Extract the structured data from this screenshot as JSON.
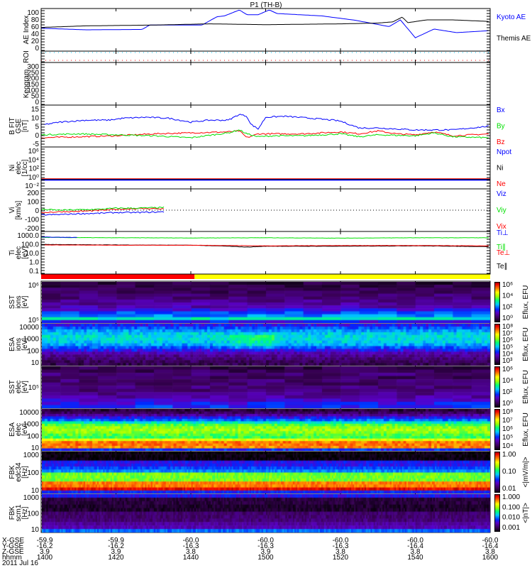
{
  "title": "P1 (TH-B)",
  "time_axis": {
    "rows": [
      {
        "label": "X-GSE",
        "values": [
          "-59.9",
          "-59.9",
          "-60.0",
          "-60.0",
          "-60.0",
          "-60.0",
          "-60.0"
        ]
      },
      {
        "label": "Y-GSE",
        "values": [
          "-16.2",
          "-16.2",
          "-16.3",
          "-16.3",
          "-16.3",
          "-16.4",
          "-16.4"
        ]
      },
      {
        "label": "Z-GSE",
        "values": [
          "3.9",
          "3.9",
          "3.8",
          "3.9",
          "3.8",
          "3.8",
          "3.8"
        ]
      },
      {
        "label": "hhmm",
        "values": [
          "1400",
          "1420",
          "1440",
          "1500",
          "1520",
          "1540",
          "1600"
        ]
      }
    ],
    "date": "2011 Jul 16"
  },
  "colors": {
    "blue": "#0000ff",
    "red": "#ff0000",
    "green": "#00e000",
    "black": "#000000",
    "cyan": "#00c8ff",
    "yellow": "#ffff00"
  },
  "chart_data": [
    {
      "type": "line",
      "name": "ae",
      "ylabel": "AE Index",
      "ylim": [
        0,
        100
      ],
      "ticks": [
        "100",
        "80",
        "60",
        "40",
        "20",
        "0"
      ],
      "series": [
        {
          "name": "Kyoto AE",
          "color": "#0000ff",
          "t": [
            0,
            12,
            27,
            29,
            43,
            47,
            49,
            53,
            55,
            58,
            61,
            63,
            75,
            84,
            93,
            96,
            100,
            105,
            111,
            120
          ],
          "v": [
            54,
            50,
            51,
            62,
            62,
            83,
            85,
            100,
            88,
            88,
            100,
            91,
            85,
            74,
            58,
            75,
            30,
            52,
            43,
            48
          ]
        },
        {
          "name": "Themis AE",
          "color": "#000000",
          "t": [
            0,
            12,
            30,
            45,
            60,
            80,
            90,
            94,
            96.5,
            98,
            103,
            110,
            120
          ],
          "v": [
            56,
            60,
            62,
            65,
            63,
            65,
            67,
            70,
            82,
            68,
            75,
            75,
            71
          ]
        }
      ]
    },
    {
      "type": "line",
      "name": "roi",
      "ylabel": "ROI",
      "series": [
        {
          "name": "roi-cyan",
          "color": "#00c8ff"
        },
        {
          "name": "roi-red",
          "color": "#ff0000"
        }
      ]
    },
    {
      "type": "line",
      "name": "keogram",
      "ylabel": "Keogram",
      "ylim": [
        0,
        300
      ],
      "ticks": [
        "300",
        "250",
        "200",
        "150",
        "100",
        "50",
        "0"
      ],
      "series": []
    },
    {
      "type": "line",
      "name": "bfield",
      "ylabel": "B FIT",
      "units": [
        "GSE",
        "[nT]"
      ],
      "ylim": [
        -5,
        15
      ],
      "ticks": [
        "15",
        "10",
        "5",
        "0",
        "-5"
      ],
      "series": [
        {
          "name": "Bz",
          "color": "#ff0000",
          "t": [
            0,
            10,
            20,
            30,
            40,
            50,
            53,
            55,
            58,
            62,
            70,
            80,
            85,
            90,
            95,
            100,
            105,
            110,
            120
          ],
          "v": [
            -1,
            -0.5,
            0,
            1,
            1.5,
            2,
            2.5,
            -1,
            1,
            1,
            1,
            2,
            1,
            2.5,
            1,
            0.5,
            2,
            0,
            1
          ]
        },
        {
          "name": "By",
          "color": "#00e000",
          "t": [
            0,
            10,
            20,
            30,
            40,
            50,
            53,
            55,
            58,
            62,
            70,
            80,
            85,
            90,
            100,
            105,
            110,
            120
          ],
          "v": [
            0.5,
            1,
            0.5,
            0,
            -1,
            1.5,
            3,
            1,
            -0.5,
            0,
            0,
            1,
            -0.5,
            0.5,
            0,
            1.5,
            -0.5,
            -1
          ]
        },
        {
          "name": "Bx",
          "color": "#0000ff",
          "t": [
            0,
            5,
            12,
            18,
            22,
            28,
            34,
            40,
            45,
            50,
            53,
            55,
            56,
            58,
            60,
            65,
            72,
            78,
            80,
            85,
            90,
            100,
            110,
            120
          ],
          "v": [
            5.5,
            7,
            8,
            8,
            9,
            9.5,
            9,
            7,
            8,
            8,
            11,
            10,
            6,
            3.5,
            9.5,
            10,
            9,
            8,
            7.5,
            4,
            4,
            3,
            3,
            5
          ]
        }
      ]
    },
    {
      "type": "line",
      "name": "density",
      "ylabel": "Ni",
      "units": [
        "elec",
        "[1/cc]"
      ],
      "ylim_log10": [
        -2,
        6
      ],
      "ticks": [
        "10⁶",
        "10⁴",
        "10²",
        "10⁰",
        "10⁻²"
      ],
      "series": [
        {
          "name": "Ne",
          "color": "#ff0000",
          "const": -0.6
        },
        {
          "name": "Ni",
          "color": "#000000",
          "const": -0.65
        },
        {
          "name": "Npot",
          "color": "#0000ff",
          "const": -0.7
        }
      ]
    },
    {
      "type": "line",
      "name": "velocity",
      "ylabel": "Vi",
      "units": [
        "[km/s]"
      ],
      "ylim": [
        -250,
        250
      ],
      "ticks": [
        "200",
        "100",
        "0",
        "-100",
        "-200"
      ],
      "series": [
        {
          "name": "Vix",
          "color": "#ff0000",
          "t": [
            0,
            5,
            10,
            15,
            20,
            25,
            30,
            33
          ],
          "v": [
            -30,
            -20,
            -15,
            -5,
            10,
            20,
            20,
            15
          ]
        },
        {
          "name": "Viy",
          "color": "#00e000",
          "t": [
            0,
            5,
            10,
            15,
            20,
            25,
            30,
            33
          ],
          "v": [
            10,
            0,
            5,
            10,
            25,
            25,
            30,
            35
          ]
        },
        {
          "name": "Viz",
          "color": "#0000ff",
          "t": [
            0,
            5,
            10,
            15,
            20,
            25,
            30,
            33
          ],
          "v": [
            -60,
            -55,
            -45,
            -40,
            -30,
            -30,
            -25,
            -20
          ]
        }
      ]
    },
    {
      "type": "line",
      "name": "temperature",
      "ylabel": "Ti",
      "units": [
        "elec",
        "[eV]"
      ],
      "ylim_log10": [
        -1.3,
        3.6
      ],
      "ticks": [
        "1000.0",
        "100.0",
        "10.0",
        "1.0",
        "0.1"
      ],
      "series": [
        {
          "name": "Te∥",
          "color": "#000000",
          "t": [
            0,
            20,
            40,
            50,
            55,
            60,
            80,
            100,
            110,
            120
          ],
          "v": [
            150,
            130,
            120,
            90,
            70,
            90,
            90,
            100,
            90,
            80
          ]
        },
        {
          "name": "Te⊥",
          "color": "#ff0000",
          "t": [
            0,
            20,
            40,
            60,
            80,
            100,
            120
          ],
          "v": [
            130,
            120,
            120,
            100,
            110,
            110,
            100
          ]
        },
        {
          "name": "Ti∥",
          "color": "#00e000",
          "t": [
            0,
            20,
            40,
            60,
            80,
            100,
            120
          ],
          "v": [
            1100,
            1000,
            950,
            1000,
            900,
            1000,
            1000
          ]
        },
        {
          "name": "Ti⊥",
          "color": "#0000ff",
          "t": [
            0,
            5,
            10
          ],
          "v": [
            1200,
            1150,
            1100
          ]
        }
      ]
    },
    {
      "type": "heatmap",
      "name": "sst-ion",
      "ylabel": "SST",
      "units": [
        "ions",
        "[eV]"
      ],
      "ticks": [
        "10⁶",
        "10⁵"
      ],
      "colorbar": {
        "label": "Eflux, EFU",
        "ticks": [
          "10⁶",
          "10⁴",
          "10²",
          "10⁰"
        ]
      },
      "profile": [
        0.08,
        0.1,
        0.12,
        0.12,
        0.15,
        0.15,
        0.18,
        0.2,
        0.22,
        0.28,
        0.35,
        0.4,
        0.5,
        0.3
      ]
    },
    {
      "type": "heatmap",
      "name": "esa-ion",
      "ylabel": "ESA",
      "units": [
        "ions",
        "[eV]"
      ],
      "ticks": [
        "10000",
        "1000",
        "100",
        "10"
      ],
      "colorbar": {
        "label": "Eflux, EFU",
        "ticks": [
          "10⁸",
          "10⁷",
          "10⁶",
          "10⁵",
          "10⁴",
          "10³"
        ]
      },
      "profile": [
        0.3,
        0.36,
        0.42,
        0.46,
        0.48,
        0.48,
        0.46,
        0.42,
        0.36,
        0.3,
        0.22,
        0.18,
        0.15,
        0.12,
        0.1
      ]
    },
    {
      "type": "heatmap",
      "name": "sst-elec",
      "ylabel": "SST",
      "units": [
        "elec",
        "[eV]"
      ],
      "ticks": [
        "10⁵"
      ],
      "colorbar": {
        "label": "Eflux, EFU",
        "ticks": [
          "10⁶",
          "10⁴",
          "10²",
          "10⁰"
        ]
      },
      "profile": [
        0.1,
        0.12,
        0.15,
        0.12,
        0.15,
        0.14,
        0.16,
        0.15,
        0.18,
        0.2,
        0.25,
        0.3,
        0.33
      ]
    },
    {
      "type": "heatmap",
      "name": "esa-elec",
      "ylabel": "ESA",
      "units": [
        "elec",
        "[eV]"
      ],
      "ticks": [
        "10000",
        "1000",
        "100",
        "10"
      ],
      "colorbar": {
        "label": "Eflux, EFU",
        "ticks": [
          "10⁸",
          "10⁷",
          "10⁶",
          "10⁵",
          "10⁴"
        ]
      },
      "profile": [
        0.08,
        0.12,
        0.2,
        0.3,
        0.38,
        0.5,
        0.6,
        0.64,
        0.66,
        0.64,
        0.6,
        0.58,
        0.72,
        0.85,
        0.86,
        0.84,
        0.33
      ]
    },
    {
      "type": "heatmap",
      "name": "fbk-edc34",
      "ylabel": "FBK",
      "units": [
        "edc34",
        "[Hz]"
      ],
      "ticks": [
        "1000",
        "100",
        "10"
      ],
      "colorbar": {
        "label": "<|mV/m|>",
        "ticks": [
          "1.00",
          "0.10",
          "0.01"
        ]
      },
      "profile": [
        0.02,
        0.02,
        0.02,
        0.3,
        0.3,
        0.35,
        0.4,
        0.62,
        0.62,
        0.62,
        0.85,
        0.85,
        0.95,
        0.32
      ]
    },
    {
      "type": "heatmap",
      "name": "fbk-scm1",
      "ylabel": "FBK",
      "units": [
        "scm1",
        "[Hz]"
      ],
      "ticks": [
        "1000",
        "100",
        "10"
      ],
      "colorbar": {
        "label": "<|nT|>",
        "ticks": [
          "1.000",
          "0.100",
          "0.010",
          "0.001"
        ]
      },
      "profile": [
        0.3,
        0.08,
        0.08,
        0.06,
        0.06,
        0.14,
        0.14,
        0.15,
        0.2,
        0.22,
        0.38
      ]
    }
  ],
  "mode_bar": {
    "segments": [
      {
        "color": "#ff0000",
        "until_min": 41
      },
      {
        "color": "#ffff00",
        "until_min": 120
      }
    ]
  }
}
